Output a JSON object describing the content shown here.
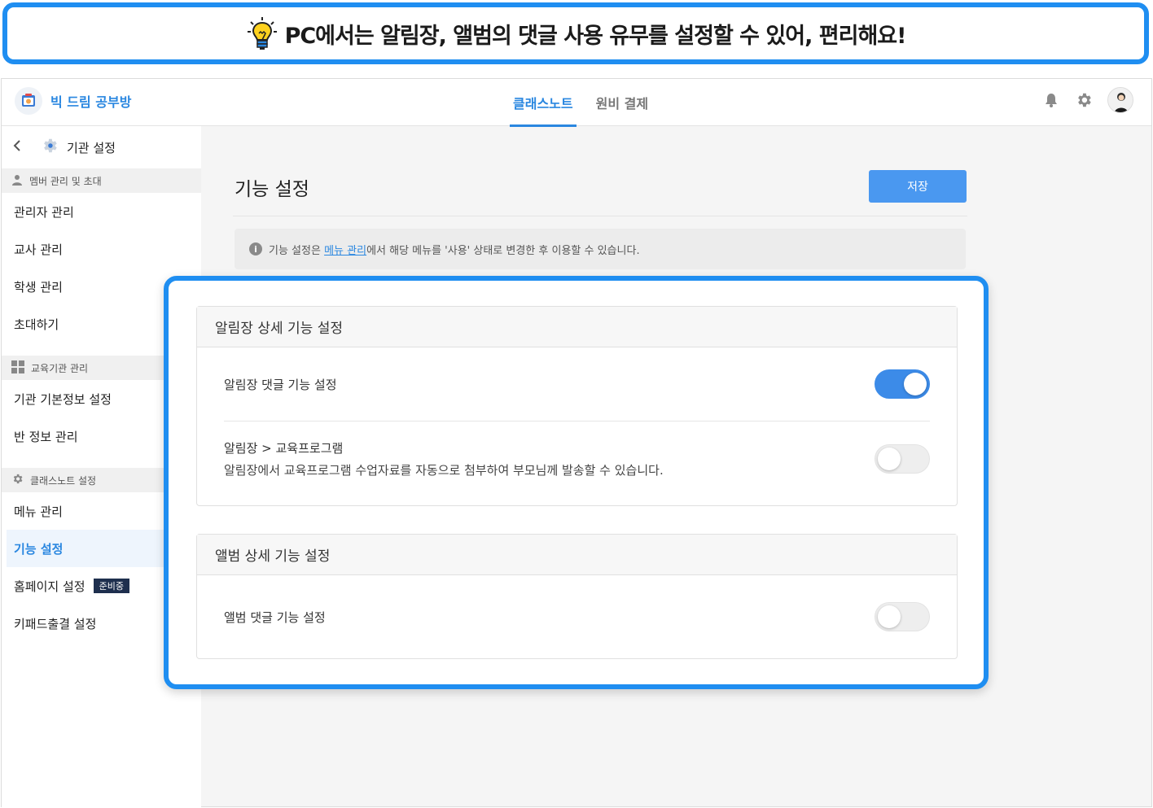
{
  "banner": {
    "text": "PC에서는 알림장, 앨범의 댓글 사용 유무를 설정할 수 있어, 편리해요!",
    "icon": "lightbulb-icon"
  },
  "header": {
    "brand_name": "빅 드림 공부방",
    "tabs": [
      {
        "label": "클래스노트",
        "active": true
      },
      {
        "label": "원비 결제",
        "active": false
      }
    ],
    "icons": [
      "bell-icon",
      "gear-icon",
      "avatar"
    ]
  },
  "sidebar": {
    "title": "기관 설정",
    "sections": [
      {
        "title": "멤버 관리 및 초대",
        "icon": "person-icon",
        "items": [
          {
            "label": "관리자 관리"
          },
          {
            "label": "교사 관리"
          },
          {
            "label": "학생 관리"
          },
          {
            "label": "초대하기"
          }
        ]
      },
      {
        "title": "교육기관 관리",
        "icon": "grid-icon",
        "items": [
          {
            "label": "기관 기본정보 설정"
          },
          {
            "label": "반 정보 관리"
          }
        ]
      },
      {
        "title": "클래스노트 설정",
        "icon": "gear-icon",
        "items": [
          {
            "label": "메뉴 관리"
          },
          {
            "label": "기능 설정",
            "active": true
          },
          {
            "label": "홈페이지 설정",
            "badge": "준비중"
          },
          {
            "label": "키패드출결 설정"
          }
        ]
      }
    ]
  },
  "main": {
    "title": "기능 설정",
    "save_label": "저장",
    "notice_prefix": "기능 설정은 ",
    "notice_link": "메뉴 관리",
    "notice_suffix": "에서 해당 메뉴를 '사용' 상태로 변경한 후 이용할 수 있습니다.",
    "cards": [
      {
        "title": "알림장 상세 기능 설정",
        "rows": [
          {
            "label": "알림장 댓글 기능 설정",
            "enabled": true
          },
          {
            "label": "알림장 > 교육프로그램",
            "desc": "알림장에서 교육프로그램 수업자료를 자동으로 첨부하여 부모님께 발송할 수 있습니다.",
            "enabled": false
          }
        ]
      },
      {
        "title": "앨범 상세 기능 설정",
        "rows": [
          {
            "label": "앨범 댓글 기능 설정",
            "enabled": false
          }
        ]
      }
    ]
  },
  "colors": {
    "accent": "#1f8ef1",
    "brand": "#2a87e0",
    "toggle_on": "#3c8be8",
    "badge_bg": "#1e2f4e"
  }
}
